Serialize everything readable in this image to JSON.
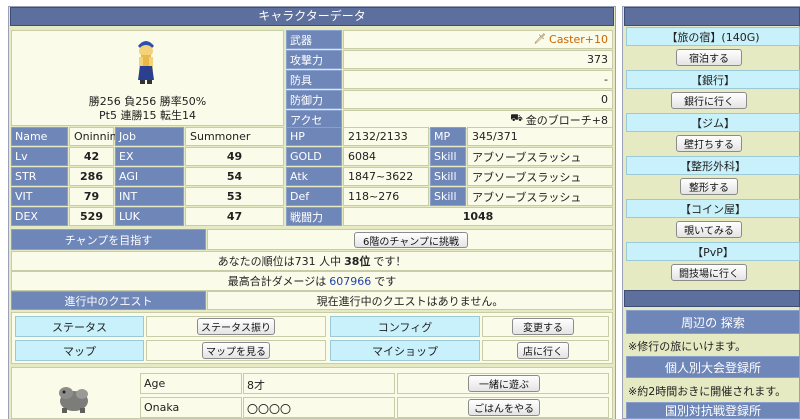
{
  "title": "キャラクターデータ",
  "character": {
    "record_line1": "勝256 負256 勝率50%",
    "record_line2": "Pt5 連勝15 転生14"
  },
  "equipment": [
    {
      "label": "武器",
      "value": "Caster+10",
      "icon": "wand-icon",
      "accent": "#cc6600"
    },
    {
      "label": "攻撃力",
      "value": "373"
    },
    {
      "label": "防具",
      "value": "-"
    },
    {
      "label": "防御力",
      "value": "0"
    },
    {
      "label": "アクセ",
      "value": "金のブローチ+8",
      "icon": "cart-icon"
    }
  ],
  "stats": {
    "name_label": "Name",
    "name": "Oninnin",
    "job_label": "Job",
    "job": "Summoner",
    "hp_label": "HP",
    "hp": "2132/2133",
    "mp_label": "MP",
    "mp": "345/371",
    "lv_label": "Lv",
    "lv": "42",
    "ex_label": "EX",
    "ex": "49",
    "gold_label": "GOLD",
    "gold": "6084",
    "skill_label": "Skill",
    "skill1": "アブソーブスラッシュ",
    "str_label": "STR",
    "str": "286",
    "agi_label": "AGI",
    "agi": "54",
    "atk_label": "Atk",
    "atk": "1847~3622",
    "skill2": "アブソーブスラッシュ",
    "vit_label": "VIT",
    "vit": "79",
    "int_label": "INT",
    "int": "53",
    "def_label": "Def",
    "def": "118~276",
    "skill3": "アブソーブスラッシュ",
    "dex_label": "DEX",
    "dex": "529",
    "luk_label": "LUK",
    "luk": "47",
    "power_label": "戦闘力",
    "power": "1048"
  },
  "champ": {
    "header": "チャンプを目指す",
    "button": "6階のチャンプに挑戦",
    "rank_prefix": "あなたの順位は731 人中",
    "rank_value": "38位",
    "rank_suffix": "です！",
    "dmg_prefix": "最高合計ダメージは",
    "dmg_value": "607966",
    "dmg_suffix": "です",
    "dmg_color": "#2244aa"
  },
  "quest": {
    "header": "進行中のクエスト",
    "text": "現在進行中のクエストはありません。"
  },
  "menu": {
    "status_label": "ステータス",
    "status_button": "ステータス振り",
    "config_label": "コンフィグ",
    "config_button": "変更する",
    "map_label": "マップ",
    "map_button": "マップを見る",
    "shop_label": "マイショップ",
    "shop_button": "店に行く"
  },
  "pet": {
    "age_label": "Age",
    "age": "8才",
    "play_button": "一緒に遊ぶ",
    "onaka_label": "Onaka",
    "onaka": "〇〇〇〇",
    "feed_button": "ごはんをやる"
  },
  "sidebar": {
    "inn_label": "【旅の宿】(140G)",
    "inn_button": "宿泊する",
    "bank_label": "【銀行】",
    "bank_button": "銀行に行く",
    "gym_label": "【ジム】",
    "gym_button": "壁打ちする",
    "surgery_label": "【整形外科】",
    "surgery_button": "整形する",
    "coin_label": "【コイン屋】",
    "coin_button": "覗いてみる",
    "pvp_label": "【PvP】",
    "pvp_button": "闘技場に行く",
    "explore_header": "周辺の 探索",
    "explore_text": "※修行の旅にいけます。",
    "tourney_header": "個人別大会登録所",
    "tourney_text": "※約2時間おきに開催されます。",
    "nation_header": "国別対抗戦登録所"
  }
}
